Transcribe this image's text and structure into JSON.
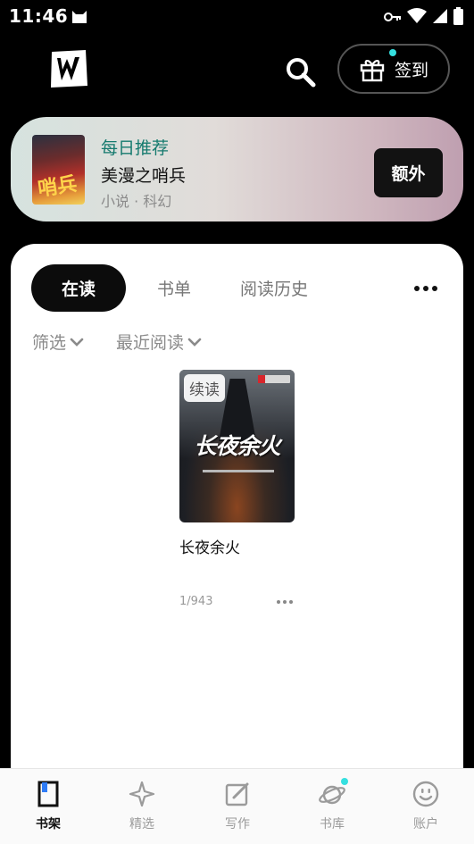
{
  "status_bar": {
    "time": "11:46"
  },
  "header": {
    "checkin_label": "签到"
  },
  "daily_recommend": {
    "label": "每日推荐",
    "cover_text": "哨兵",
    "title": "美漫之哨兵",
    "meta": "小说 · 科幻",
    "extra_button": "额外"
  },
  "tabs": [
    {
      "label": "在读",
      "active": true
    },
    {
      "label": "书单",
      "active": false
    },
    {
      "label": "阅读历史",
      "active": false
    }
  ],
  "filters": {
    "filter_label": "筛选",
    "sort_label": "最近阅读"
  },
  "books": [
    {
      "badge": "续读",
      "cover_title": "长夜余火",
      "title": "长夜余火",
      "progress": "1/943"
    }
  ],
  "bottom_nav": [
    {
      "label": "书架",
      "icon": "bookshelf-icon",
      "active": true
    },
    {
      "label": "精选",
      "icon": "sparkle-icon",
      "active": false
    },
    {
      "label": "写作",
      "icon": "edit-icon",
      "active": false
    },
    {
      "label": "书库",
      "icon": "planet-icon",
      "active": false,
      "dot": true
    },
    {
      "label": "账户",
      "icon": "smiley-icon",
      "active": false
    }
  ],
  "colors": {
    "accent_dot": "#35e0e0",
    "daily_label": "#157a6e"
  }
}
